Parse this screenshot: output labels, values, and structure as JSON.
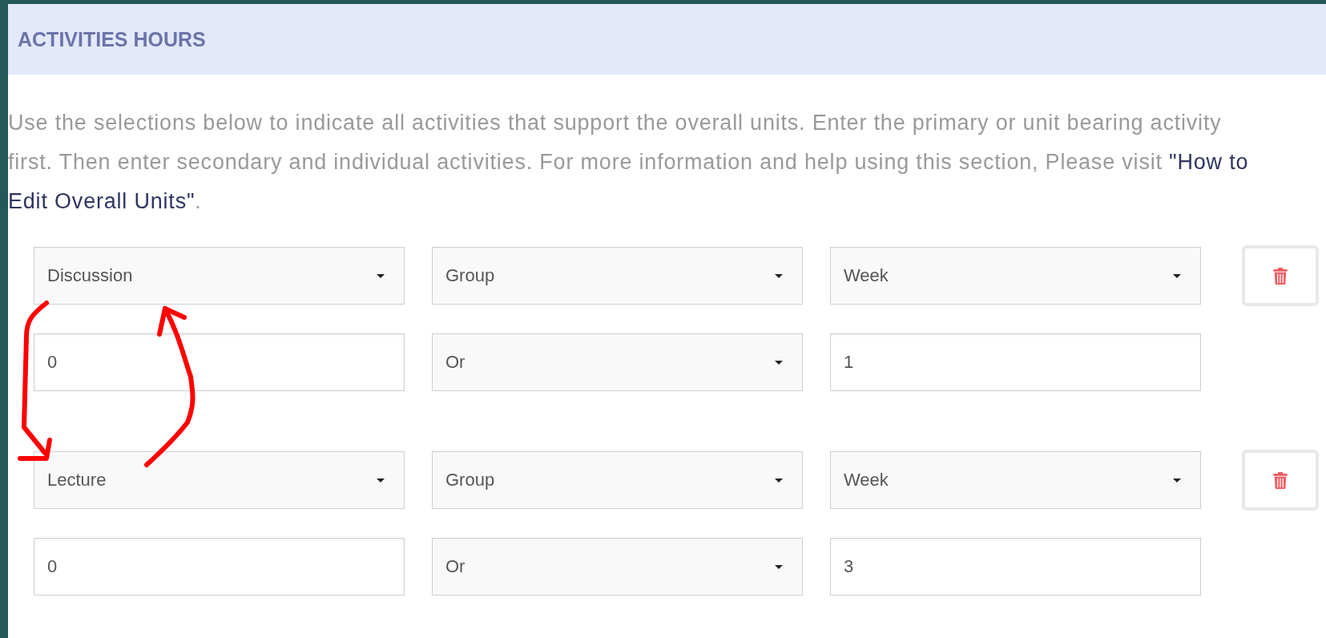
{
  "section": {
    "title": "ACTIVITIES HOURS"
  },
  "instructions": {
    "lines": [
      {
        "text": "Use the selections below to indicate all activities that support the overall units. Enter the primary or unit bearing activity"
      },
      {
        "text": "first. Then enter secondary and individual activities. For more information and help using this section, Please visit ",
        "link": "\"How to"
      },
      {
        "link": "Edit Overall Units\"",
        "after": "."
      }
    ]
  },
  "activities": [
    {
      "activity": "Discussion",
      "grouping": "Group",
      "period": "Week",
      "hours": "0",
      "operator": "Or",
      "count": "1"
    },
    {
      "activity": "Lecture",
      "grouping": "Group",
      "period": "Week",
      "hours": "0",
      "operator": "Or",
      "count": "3"
    }
  ]
}
